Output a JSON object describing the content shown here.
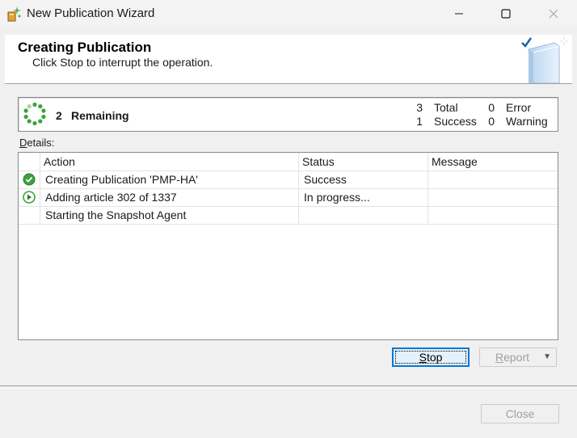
{
  "window": {
    "title": "New Publication Wizard",
    "icons": {
      "app": "wizard-sparkle-icon",
      "minimize": "minimize-icon",
      "maximize": "maximize-icon",
      "close": "close-icon"
    }
  },
  "header": {
    "title": "Creating Publication",
    "subtitle": "Click Stop to interrupt the operation.",
    "art_icon": "book-check-icon"
  },
  "summary": {
    "remaining_count": "2",
    "remaining_label": "Remaining",
    "total_count": "3",
    "total_label": "Total",
    "success_count": "1",
    "success_label": "Success",
    "error_count": "0",
    "error_label": "Error",
    "warning_count": "0",
    "warning_label": "Warning",
    "spinner_icon": "progress-spinner-icon"
  },
  "details": {
    "label_accel": "D",
    "label_rest": "etails:",
    "columns": [
      "Action",
      "Status",
      "Message"
    ],
    "rows": [
      {
        "icon": "success-check-icon",
        "action": "Creating Publication 'PMP-HA'",
        "status": "Success",
        "message": ""
      },
      {
        "icon": "in-progress-play-icon",
        "action": "Adding article 302 of 1337",
        "status": "In progress...",
        "message": ""
      },
      {
        "icon": "",
        "action": "Starting the Snapshot Agent",
        "status": "",
        "message": ""
      }
    ]
  },
  "buttons": {
    "stop_accel": "S",
    "stop_rest": "top",
    "report_accel": "R",
    "report_rest": "eport",
    "close": "Close"
  },
  "colors": {
    "accent": "#0078d7",
    "success_green": "#3ca33c",
    "disabled_text": "#a0a0a0"
  }
}
